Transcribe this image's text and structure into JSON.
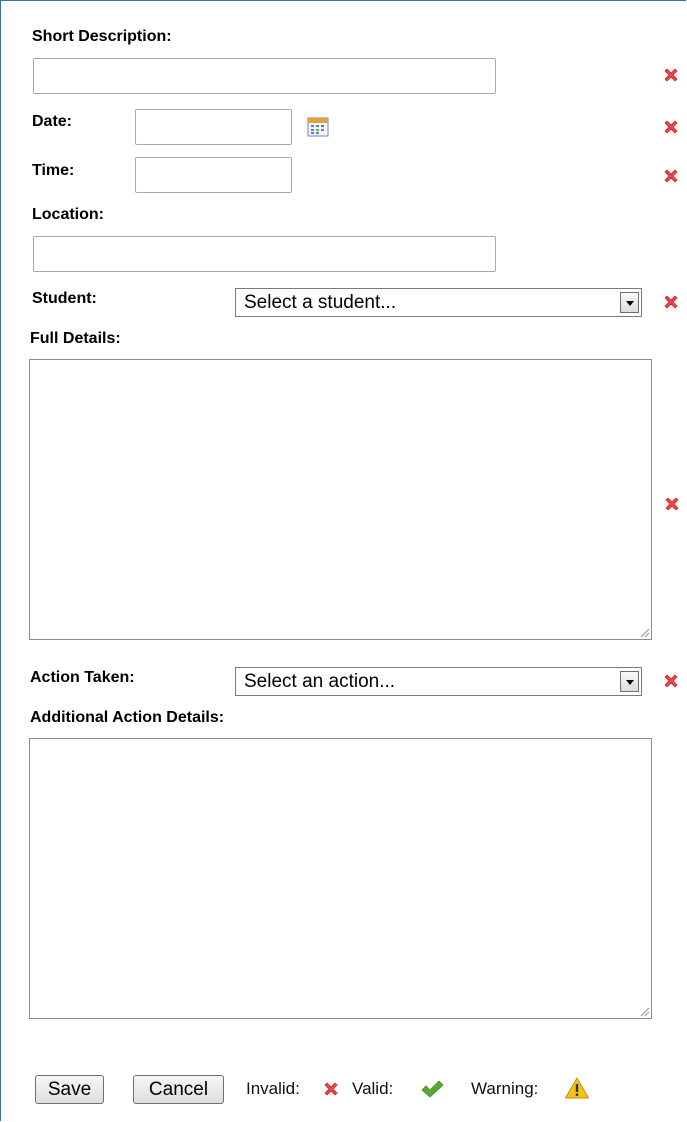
{
  "form": {
    "short_description": {
      "label": "Short Description:",
      "value": ""
    },
    "date": {
      "label": "Date:",
      "value": ""
    },
    "time": {
      "label": "Time:",
      "value": ""
    },
    "location": {
      "label": "Location:",
      "value": ""
    },
    "student": {
      "label": "Student:",
      "selected": "Select a student..."
    },
    "full_details": {
      "label": "Full Details:",
      "value": ""
    },
    "action_taken": {
      "label": "Action Taken:",
      "selected": "Select an action..."
    },
    "additional_action_details": {
      "label": "Additional Action Details:",
      "value": ""
    }
  },
  "buttons": {
    "save": "Save",
    "cancel": "Cancel"
  },
  "legend": {
    "invalid": "Invalid:",
    "valid": "Valid:",
    "warning": "Warning:"
  },
  "icons": {
    "invalid": "red-x-icon",
    "valid": "green-check-icon",
    "warning": "warning-triangle-icon",
    "calendar": "calendar-icon"
  },
  "colors": {
    "invalid": "#e8464b",
    "valid": "#5aa832",
    "warning": "#f5c21a",
    "frame_border": "#3a6ea5"
  }
}
